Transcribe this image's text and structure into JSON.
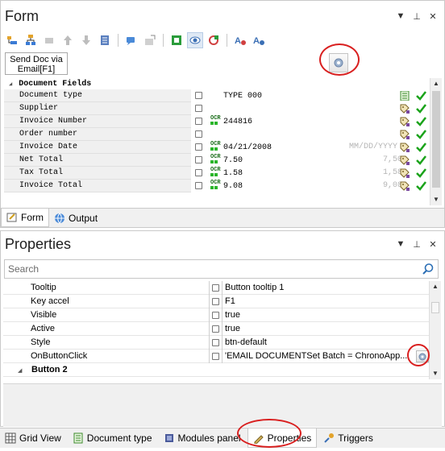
{
  "form_panel": {
    "title": "Form",
    "send_doc_button": "Send Doc via Email[F1]",
    "grid": {
      "section_label": "Document Fields",
      "rows": [
        {
          "name": "Document type",
          "ocr": false,
          "value": "TYPE 000",
          "mask": "",
          "gray": "",
          "icon": "document-list-icon"
        },
        {
          "name": "Supplier",
          "ocr": false,
          "value": "",
          "mask": "",
          "gray": "",
          "icon": "tag-icon"
        },
        {
          "name": "Invoice Number",
          "ocr": true,
          "value": "244816",
          "mask": "",
          "gray": "",
          "icon": "tag-icon"
        },
        {
          "name": "Order number",
          "ocr": false,
          "value": "",
          "mask": "",
          "gray": "",
          "icon": "tag-icon"
        },
        {
          "name": "Invoice Date",
          "ocr": true,
          "value": "04/21/2008",
          "mask": "MM/DD/YYYY",
          "gray": "",
          "icon": "tag-icon"
        },
        {
          "name": "Net Total",
          "ocr": true,
          "value": "7.50",
          "mask": "",
          "gray": "7,50",
          "icon": "tag-icon"
        },
        {
          "name": "Tax Total",
          "ocr": true,
          "value": "1.58",
          "mask": "",
          "gray": "1,58",
          "icon": "tag-icon"
        },
        {
          "name": "Invoice Total",
          "ocr": true,
          "value": "9.08",
          "mask": "",
          "gray": "9,08",
          "icon": "tag-icon"
        }
      ]
    },
    "ocr_label": "OCR",
    "tabs": [
      {
        "label": "Form",
        "icon": "form-edit-icon"
      },
      {
        "label": "Output",
        "icon": "globe-icon"
      }
    ]
  },
  "properties_panel": {
    "title": "Properties",
    "search_placeholder": "Search",
    "rows": [
      {
        "name": "Tooltip",
        "value": "Button tooltip 1"
      },
      {
        "name": "Key accel",
        "value": "F1"
      },
      {
        "name": "Visible",
        "value": "true"
      },
      {
        "name": "Active",
        "value": "true"
      },
      {
        "name": "Style",
        "value": "btn-default"
      },
      {
        "name": "OnButtonClick",
        "value": "'EMAIL DOCUMENTSet Batch = ChronoApp...."
      }
    ],
    "group_label": "Button 2"
  },
  "bottom_tabs": [
    {
      "label": "Grid View",
      "icon": "grid-icon"
    },
    {
      "label": "Document type",
      "icon": "document-icon"
    },
    {
      "label": "Modules panel",
      "icon": "modules-icon"
    },
    {
      "label": "Properties",
      "icon": "properties-icon"
    },
    {
      "label": "Triggers",
      "icon": "triggers-icon"
    }
  ],
  "colors": {
    "check_green": "#1aa31a",
    "annotation_red": "#d91f1f",
    "ocr_green": "#2bb52b"
  }
}
